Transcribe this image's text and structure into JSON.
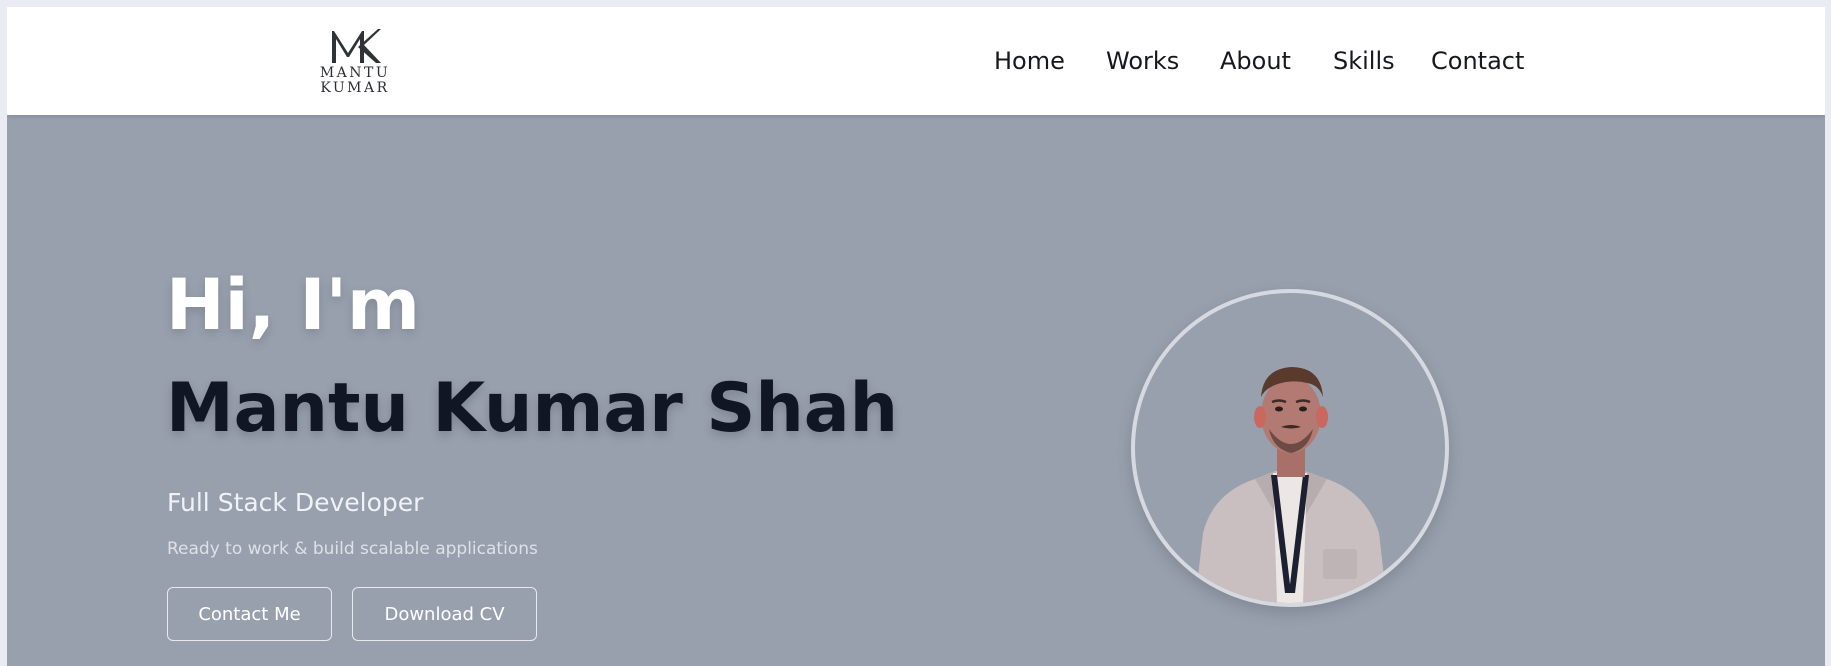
{
  "header": {
    "logo": {
      "line1": "MANTU",
      "line2": "KUMAR"
    },
    "nav": [
      {
        "label": "Home"
      },
      {
        "label": "Works"
      },
      {
        "label": "About"
      },
      {
        "label": "Skills"
      },
      {
        "label": "Contact"
      }
    ]
  },
  "hero": {
    "greeting": "Hi, I'm",
    "name": "Mantu Kumar Shah",
    "role": "Full Stack Developer",
    "tagline": "Ready to work & build scalable applications",
    "buttons": {
      "contact": "Contact Me",
      "cv": "Download CV"
    },
    "avatar_icon": "profile-photo"
  },
  "colors": {
    "hero_background": "#98a0ae",
    "header_background": "#ffffff",
    "name_color": "#101623",
    "greeting_color": "#ffffff"
  }
}
